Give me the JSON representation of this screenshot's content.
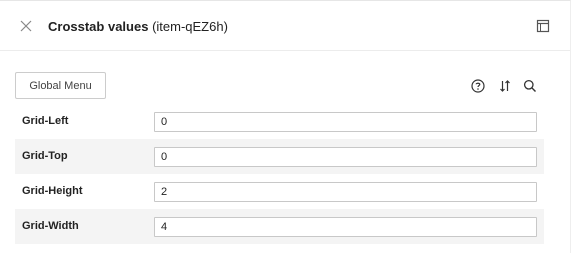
{
  "header": {
    "title_main": "Crosstab values",
    "title_item": "(item-qEZ6h)",
    "close_icon": "close-icon",
    "maximize_icon": "maximize-icon"
  },
  "toolbar": {
    "global_menu_label": "Global Menu",
    "icons": [
      "help-circle-icon",
      "sort-icon",
      "search-icon"
    ]
  },
  "fields": [
    {
      "label": "Grid-Left",
      "value": "0"
    },
    {
      "label": "Grid-Top",
      "value": "0"
    },
    {
      "label": "Grid-Height",
      "value": "2"
    },
    {
      "label": "Grid-Width",
      "value": "4"
    }
  ],
  "colors": {
    "row_alt_bg": "#f4f4f4",
    "border": "#c8c8c8",
    "text": "#222222"
  }
}
